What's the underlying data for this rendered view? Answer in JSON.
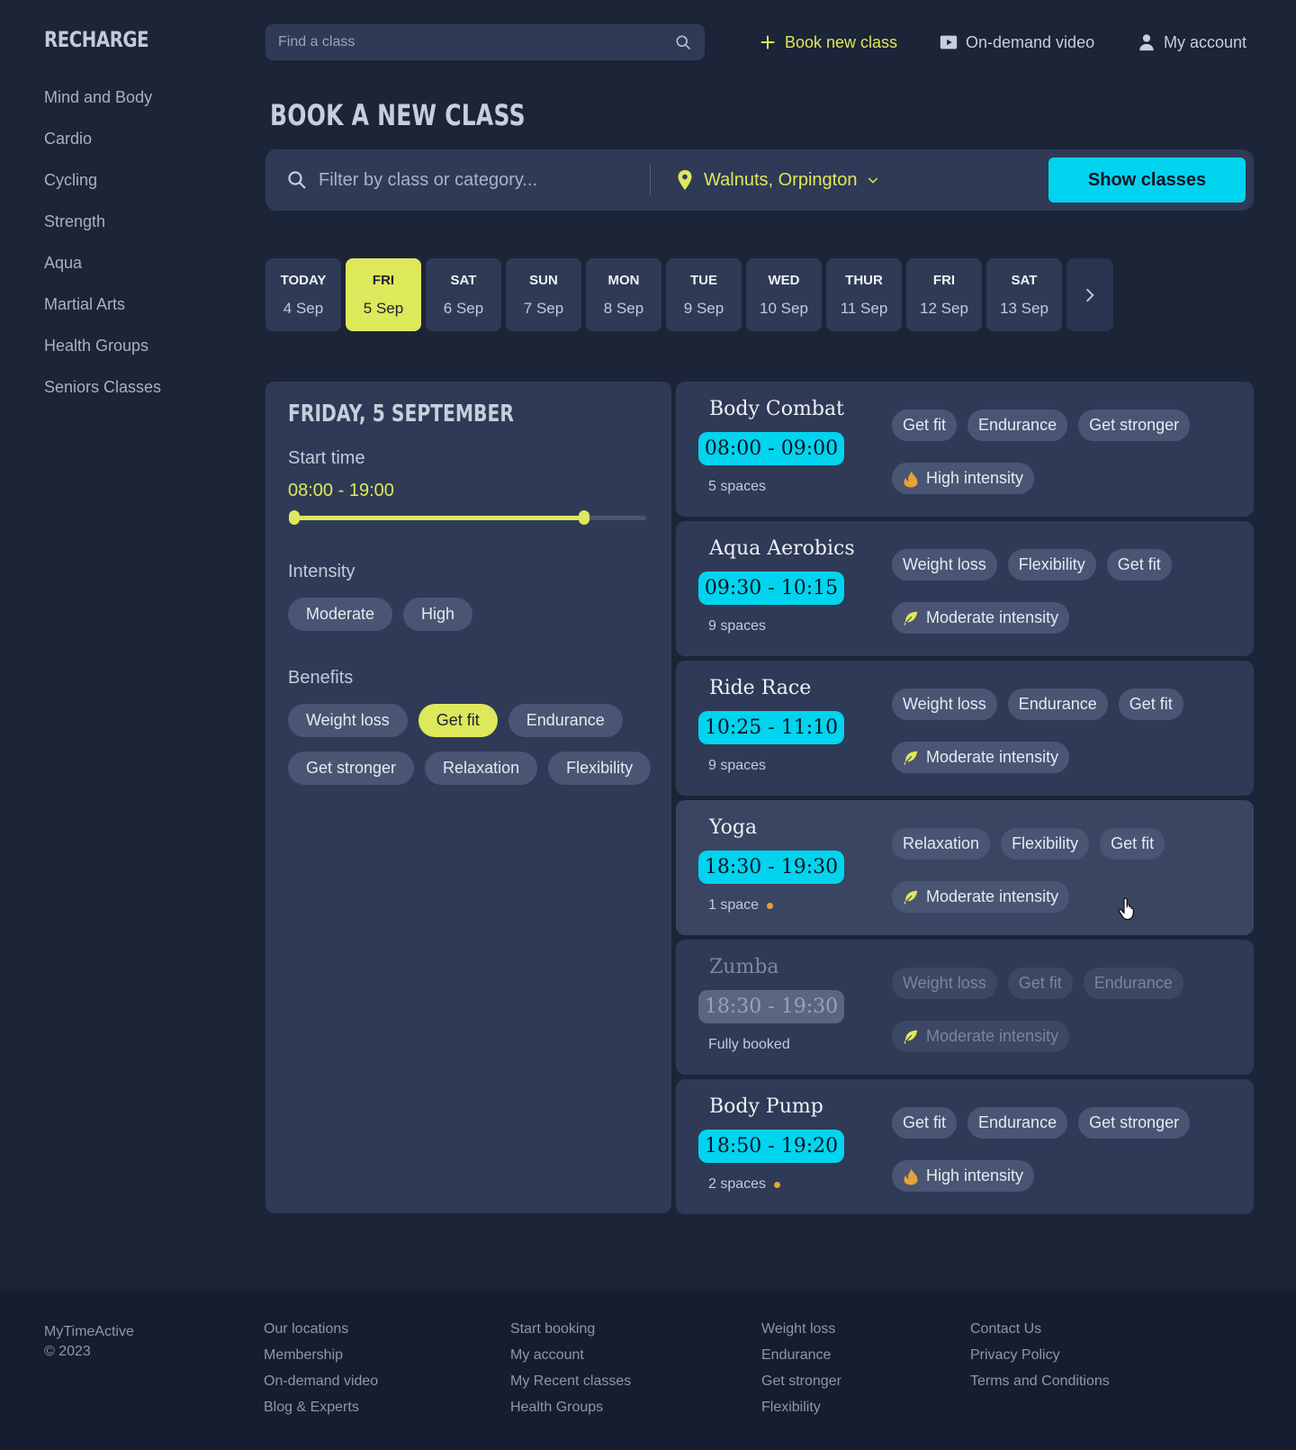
{
  "brand": "RECHARGE",
  "sidebar": {
    "items": [
      {
        "label": "Mind and Body"
      },
      {
        "label": "Cardio"
      },
      {
        "label": "Cycling"
      },
      {
        "label": "Strength"
      },
      {
        "label": "Aqua"
      },
      {
        "label": "Martial Arts"
      },
      {
        "label": "Health Groups"
      },
      {
        "label": "Seniors Classes"
      }
    ]
  },
  "header": {
    "search_placeholder": "Find a class",
    "book_new_class": "Book new class",
    "on_demand_video": "On-demand video",
    "my_account": "My account"
  },
  "page_title": "BOOK A NEW CLASS",
  "filter_bar": {
    "placeholder": "Filter by class or category...",
    "location": "Walnuts, Orpington",
    "show_button": "Show classes"
  },
  "days": [
    {
      "dow": "TODAY",
      "date": "4 Sep",
      "active": false
    },
    {
      "dow": "FRI",
      "date": "5 Sep",
      "active": true
    },
    {
      "dow": "SAT",
      "date": "6 Sep",
      "active": false
    },
    {
      "dow": "SUN",
      "date": "7 Sep",
      "active": false
    },
    {
      "dow": "MON",
      "date": "8 Sep",
      "active": false
    },
    {
      "dow": "TUE",
      "date": "9 Sep",
      "active": false
    },
    {
      "dow": "WED",
      "date": "10 Sep",
      "active": false
    },
    {
      "dow": "THUR",
      "date": "11 Sep",
      "active": false
    },
    {
      "dow": "FRI",
      "date": "12 Sep",
      "active": false
    },
    {
      "dow": "SAT",
      "date": "13 Sep",
      "active": false
    }
  ],
  "panel": {
    "date_heading": "FRIDAY, 5 SEPTEMBER",
    "start_time_label": "Start time",
    "start_time_range": "08:00 - 19:00",
    "slider_min_fraction": 0,
    "slider_max_fraction": 0.81,
    "intensity_label": "Intensity",
    "intensity_options": [
      {
        "label": "Moderate",
        "active": false
      },
      {
        "label": "High",
        "active": false
      }
    ],
    "benefits_label": "Benefits",
    "benefit_options": [
      {
        "label": "Weight loss",
        "active": false
      },
      {
        "label": "Get fit",
        "active": true
      },
      {
        "label": "Endurance",
        "active": false
      },
      {
        "label": "Get stronger",
        "active": false
      },
      {
        "label": "Relaxation",
        "active": false
      },
      {
        "label": "Flexibility",
        "active": false
      }
    ]
  },
  "classes": [
    {
      "name": "Body Combat",
      "time": "08:00 - 09:00",
      "spaces": "5 spaces",
      "low_spaces": false,
      "tags": [
        "Get fit",
        "Endurance",
        "Get stronger"
      ],
      "intensity": "High intensity",
      "intensity_icon": "flame-icon",
      "state": "normal"
    },
    {
      "name": "Aqua Aerobics",
      "time": "09:30 - 10:15",
      "spaces": "9 spaces",
      "low_spaces": false,
      "tags": [
        "Weight loss",
        "Flexibility",
        "Get fit"
      ],
      "intensity": "Moderate intensity",
      "intensity_icon": "leaf-icon",
      "state": "normal"
    },
    {
      "name": "Ride Race",
      "time": "10:25 - 11:10",
      "spaces": "9 spaces",
      "low_spaces": false,
      "tags": [
        "Weight loss",
        "Endurance",
        "Get fit"
      ],
      "intensity": "Moderate intensity",
      "intensity_icon": "leaf-icon",
      "state": "normal"
    },
    {
      "name": "Yoga",
      "time": "18:30 - 19:30",
      "spaces": "1 space",
      "low_spaces": true,
      "tags": [
        "Relaxation",
        "Flexibility",
        "Get fit"
      ],
      "intensity": "Moderate intensity",
      "intensity_icon": "leaf-icon",
      "state": "hover"
    },
    {
      "name": "Zumba",
      "time": "18:30 - 19:30",
      "spaces": "Fully booked",
      "low_spaces": false,
      "tags": [
        "Weight loss",
        "Get fit",
        "Endurance"
      ],
      "intensity": "Moderate intensity",
      "intensity_icon": "leaf-icon",
      "state": "disabled"
    },
    {
      "name": "Body Pump",
      "time": "18:50 - 19:20",
      "spaces": "2 spaces",
      "low_spaces": true,
      "tags": [
        "Get fit",
        "Endurance",
        "Get stronger"
      ],
      "intensity": "High intensity",
      "intensity_icon": "flame-icon",
      "state": "normal"
    }
  ],
  "footer": {
    "company": "MyTimeActive",
    "copyright": "© 2023",
    "columns": [
      [
        "Our locations",
        "Membership",
        "On-demand video",
        "Blog & Experts"
      ],
      [
        "Start booking",
        "My account",
        "My Recent classes",
        "Health Groups"
      ],
      [
        "Weight loss",
        "Endurance",
        "Get stronger",
        "Flexibility"
      ],
      [
        "Contact Us",
        "Privacy Policy",
        "Terms and Conditions"
      ]
    ]
  },
  "colors": {
    "background": "#1c2438",
    "panel": "#2f3a56",
    "accent_yellow": "#dde85a",
    "accent_cyan": "#00d4ee",
    "low_space_dot": "#e8a23a"
  }
}
